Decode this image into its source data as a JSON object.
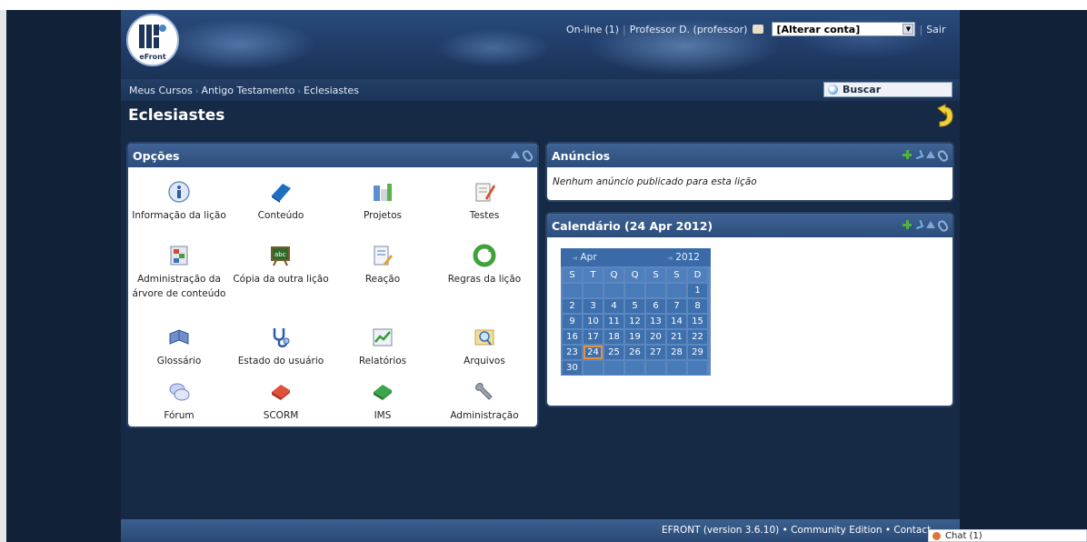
{
  "header": {
    "logo_text": "eFront",
    "online_link": "On-line",
    "online_count": "(1)",
    "user_name": "Professor D. (professor)",
    "switch_account": "[Alterar conta]",
    "logout": "Sair"
  },
  "breadcrumb": [
    "Meus Cursos",
    "Antigo Testamento",
    "Eclesiastes"
  ],
  "search": {
    "label": "Buscar"
  },
  "page": {
    "title": "Eclesiastes"
  },
  "options_panel": {
    "title": "Opções",
    "items": [
      {
        "label": "Informação da lição",
        "icon": "info-icon"
      },
      {
        "label": "Conteúdo",
        "icon": "book-icon"
      },
      {
        "label": "Projetos",
        "icon": "projects-icon"
      },
      {
        "label": "Testes",
        "icon": "tests-icon"
      },
      {
        "label": "Administração da árvore de conteúdo",
        "icon": "content-tree-icon"
      },
      {
        "label": "Cópia da outra lição",
        "icon": "copy-lesson-icon"
      },
      {
        "label": "Reação",
        "icon": "feedback-icon"
      },
      {
        "label": "Regras da lição",
        "icon": "rules-icon"
      },
      {
        "label": "Glossário",
        "icon": "glossary-icon"
      },
      {
        "label": "Estado do usuário",
        "icon": "stethoscope-icon"
      },
      {
        "label": "Relatórios",
        "icon": "reports-icon"
      },
      {
        "label": "Arquivos",
        "icon": "files-icon"
      },
      {
        "label": "Fórum",
        "icon": "forum-icon"
      },
      {
        "label": "SCORM",
        "icon": "scorm-icon"
      },
      {
        "label": "IMS",
        "icon": "ims-icon"
      },
      {
        "label": "Administração",
        "icon": "wrench-icon"
      }
    ]
  },
  "announcements": {
    "title": "Anúncios",
    "empty_message": "Nenhum anúncio publicado para esta lição"
  },
  "calendar": {
    "title": "Calendário (24 Apr 2012)",
    "month": "Apr",
    "year": "2012",
    "weekdays": [
      "S",
      "T",
      "Q",
      "Q",
      "S",
      "S",
      "D"
    ],
    "days": [
      "",
      "",
      "",
      "",
      "",
      "",
      "1",
      "2",
      "3",
      "4",
      "5",
      "6",
      "7",
      "8",
      "9",
      "10",
      "11",
      "12",
      "13",
      "14",
      "15",
      "16",
      "17",
      "18",
      "19",
      "20",
      "21",
      "22",
      "23",
      "24",
      "25",
      "26",
      "27",
      "28",
      "29",
      "30",
      "",
      "",
      "",
      "",
      "",
      ""
    ],
    "today": "24"
  },
  "footer": {
    "text": "EFRONT (version 3.6.10) • Community Edition • Contact"
  },
  "chat": {
    "label": "Chat (1)"
  }
}
